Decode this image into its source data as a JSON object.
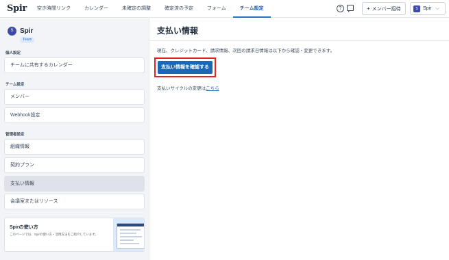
{
  "header": {
    "logo": "Spir",
    "nav": [
      {
        "label": "空き時間リンク"
      },
      {
        "label": "カレンダー"
      },
      {
        "label": "未確定の調整"
      },
      {
        "label": "確定済の予定"
      },
      {
        "label": "フォーム"
      },
      {
        "label": "チーム設定"
      }
    ],
    "active_nav": "チーム設定",
    "help_glyph": "?",
    "invite_label": "メンバー招待",
    "user": {
      "avatar_letter": "S",
      "name": "Spir",
      "chevron": "⌵"
    }
  },
  "sidebar": {
    "team_avatar_letter": "S",
    "team_name": "Spir",
    "team_badge": "Team",
    "personal_label": "個人設定",
    "personal_items": [
      {
        "label": "チームに共有するカレンダー"
      }
    ],
    "team_label": "チーム設定",
    "team_items": [
      {
        "label": "メンバー"
      },
      {
        "label": "Webhook設定"
      }
    ],
    "admin_label": "管理者設定",
    "admin_items": [
      {
        "label": "組織情報"
      },
      {
        "label": "契約プラン"
      },
      {
        "label": "支払い情報",
        "active": true
      },
      {
        "label": "会議室またはリソース"
      }
    ],
    "promo": {
      "title": "Spirの使い方",
      "desc": "このページでは、Spirの使い方・活用方法をご紹介しています。"
    }
  },
  "main": {
    "title": "支払い情報",
    "description": "現在、クレジットカード、請求情報、次回の請求日情報は以下から確認・変更できます。",
    "confirm_button": "支払い情報を確認する",
    "cycle_text": "支払いサイクルの変更は",
    "cycle_link": "こちら"
  },
  "colors": {
    "accent": "#1a68b5",
    "highlight": "#e8201f",
    "avatar": "#3d4aa8"
  }
}
